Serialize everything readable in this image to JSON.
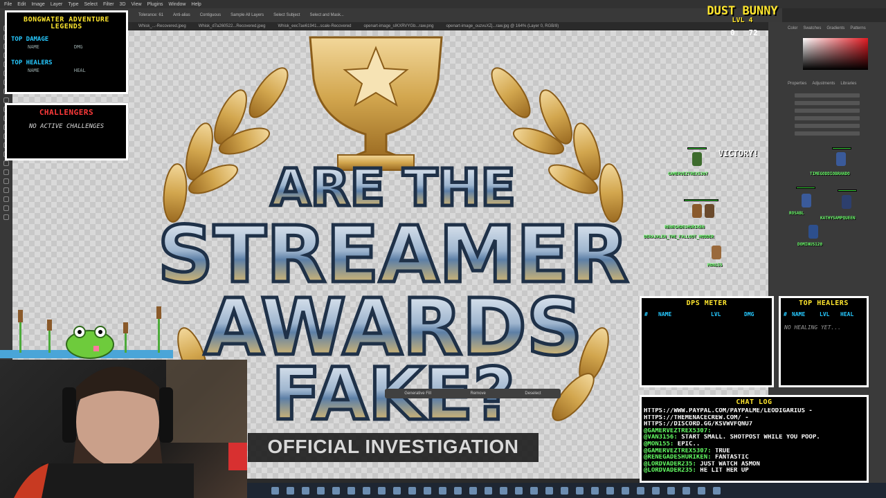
{
  "photoshop": {
    "menu": [
      "File",
      "Edit",
      "Image",
      "Layer",
      "Type",
      "Select",
      "Filter",
      "3D",
      "View",
      "Plugins",
      "Window",
      "Help"
    ],
    "options": [
      "Tolerance: 61",
      "Anti-alias",
      "Contiguous",
      "Sample All Layers",
      "Select Subject",
      "Select and Mask..."
    ],
    "tabs": [
      "Whisk_...-Recovered.jpeg",
      "Whisk_d7a260522...Recovered.jpeg",
      "Whisk_eec7ae61941...scale-Recovered",
      "openart-image_sIKXRVYGb...raw.png",
      "openart-image_ouzvuXZj...raw.jpg @ 164% (Layer 0, RGB/8)"
    ],
    "right_panel_tabs": [
      "Color",
      "Swatches",
      "Gradients",
      "Patterns"
    ],
    "properties_tabs": [
      "Properties",
      "Adjustments",
      "Libraries"
    ],
    "context_bar": [
      "Generative Fill",
      "Remove",
      "Deselect"
    ]
  },
  "artwork": {
    "line1": "ARE THE",
    "line2": "STREAMER",
    "line3": "AWARDS",
    "line4": "FAKE?",
    "subtitle": "OFFICIAL INVESTIGATION"
  },
  "overlay": {
    "game_title": "DUST BUNNY",
    "game_level": "LVL 4",
    "game_stats": "0   72",
    "victory": "VICTORY!",
    "legends": {
      "title": "BONGWATER ADVENTURE LEGENDS",
      "top_damage": "TOP DAMAGE",
      "dmg_cols": [
        "NAME",
        "DMG"
      ],
      "top_healers": "TOP HEALERS",
      "heal_cols": [
        "NAME",
        "HEAL"
      ]
    },
    "challenges": {
      "title": "CHALLENGERS",
      "empty": "NO ACTIVE CHALLENGES"
    },
    "dps": {
      "title": "DPS METER",
      "cols": [
        "#",
        "NAME",
        "LVL",
        "DMG"
      ]
    },
    "healers": {
      "title": "TOP HEALERS",
      "cols": [
        "#",
        "NAME",
        "LVL",
        "HEAL"
      ],
      "empty": "NO HEALING YET..."
    },
    "sprites": [
      "GAMERVEZTREX5307",
      "TIMEGODDIOBRANDO",
      "RENEGADESHURIKEN",
      "KATHYSAMPQUEEN",
      "DERAJALEN_THE_FALLOUT_MODDER",
      "DOMINUS120",
      "MON155",
      "ROSABL"
    ],
    "chat": {
      "title": "CHAT LOG",
      "lines": [
        {
          "user": "",
          "text": "HTTPS://WWW.PAYPAL.COM/PAYPALME/LEODIGARIUS -"
        },
        {
          "user": "",
          "text": "HTTPS://THEMENACECREW.COM/ -"
        },
        {
          "user": "",
          "text": "HTTPS://DISCORD.GG/KSVWVFQNU7"
        },
        {
          "user": "@GAMERVEZTREX5307:",
          "text": ""
        },
        {
          "user": "@VAN3156:",
          "text": "START SMALL. SHOTPOST WHILE YOU POOP."
        },
        {
          "user": "@MON155:",
          "text": "EPIC.."
        },
        {
          "user": "@GAMERVEZTREX5307:",
          "text": "TRUE"
        },
        {
          "user": "@RENEGADESHURIKEN:",
          "text": "FANTASTIC"
        },
        {
          "user": "@LORDVADER235:",
          "text": "JUST WATCH ASMON"
        },
        {
          "user": "@LORDVADER235:",
          "text": "HE LIT HER UP"
        }
      ]
    }
  },
  "colors": {
    "accent_cyan": "#26c9ff",
    "accent_yellow": "#ffe62e",
    "accent_red": "#ff3a3a",
    "chat_user_green": "#64ff64"
  }
}
